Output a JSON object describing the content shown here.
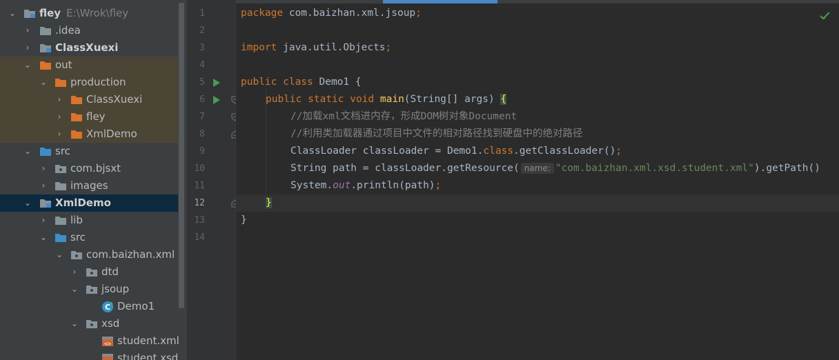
{
  "project_tree": {
    "root": {
      "name": "fley",
      "path": "E:\\Wrok\\fley"
    },
    "items": [
      {
        "label": ".idea"
      },
      {
        "label": "ClassXuexi"
      },
      {
        "label": "out"
      },
      {
        "label": "production"
      },
      {
        "label": "ClassXuexi"
      },
      {
        "label": "fley"
      },
      {
        "label": "XmlDemo"
      },
      {
        "label": "src"
      },
      {
        "label": "com.bjsxt"
      },
      {
        "label": "images"
      },
      {
        "label": "XmlDemo"
      },
      {
        "label": "lib"
      },
      {
        "label": "src"
      },
      {
        "label": "com.baizhan.xml"
      },
      {
        "label": "dtd"
      },
      {
        "label": "jsoup"
      },
      {
        "label": "Demo1"
      },
      {
        "label": "xsd"
      },
      {
        "label": "student.xml"
      },
      {
        "label": "student.xsd"
      }
    ]
  },
  "editor": {
    "line_numbers": [
      "1",
      "2",
      "3",
      "4",
      "5",
      "6",
      "7",
      "8",
      "9",
      "10",
      "11",
      "12",
      "13",
      "14"
    ],
    "current_line": "12",
    "lines": {
      "l1": {
        "kw": "package",
        "rest": " com.baizhan.xml.jsoup",
        "semi": ";"
      },
      "l3": {
        "kw": "import",
        "rest": " java.util.Objects",
        "semi": ";"
      },
      "l5": {
        "kw": "public class",
        "rest": " Demo1 {"
      },
      "l6": {
        "kw": "public static void",
        "name": "main",
        "rest": "(String[] args) ",
        "brace": "{"
      },
      "l7": {
        "comment": "//加载xml文档进内存，形成DOM树对象Document"
      },
      "l8": {
        "comment": "//利用类加载器通过项目中文件的相对路径找到硬盘中的绝对路径"
      },
      "l9": {
        "a": "ClassLoader classLoader = Demo1.",
        "kw": "class",
        "b": ".getClassLoader()",
        "semi": ";"
      },
      "l10": {
        "a": "String path = classLoader.getResource(",
        "hint": "name:",
        "str": "\"com.baizhan.xml.xsd.student.xml\"",
        "b": ").getPath()"
      },
      "l11": {
        "a": "System.",
        "field": "out",
        "b": ".println(path)",
        "semi": ";"
      },
      "l12": {
        "brace": "}"
      },
      "l13": {
        "text": "}"
      }
    }
  },
  "colors": {
    "tree_bg": "#3c3f41",
    "editor_bg": "#2b2b2b",
    "keyword": "#cc7832",
    "method": "#ffc66d",
    "comment": "#808080",
    "string": "#6a8759",
    "selection": "#0d293e"
  }
}
